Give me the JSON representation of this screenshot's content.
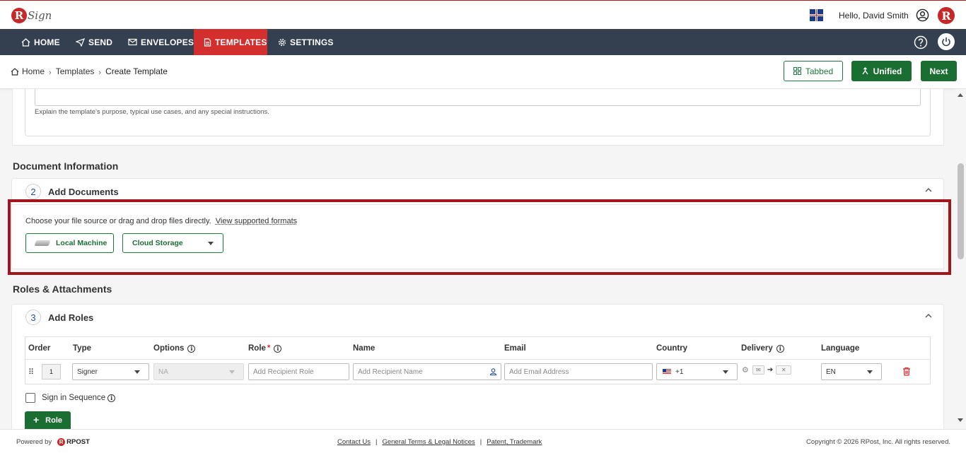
{
  "header": {
    "logo_text": "Sign",
    "greeting": "Hello, David Smith"
  },
  "nav": {
    "items": [
      {
        "label": "HOME",
        "icon": "home-icon"
      },
      {
        "label": "SEND",
        "icon": "send-icon"
      },
      {
        "label": "ENVELOPES",
        "icon": "envelope-icon"
      },
      {
        "label": "TEMPLATES",
        "icon": "document-icon",
        "active": true
      },
      {
        "label": "SETTINGS",
        "icon": "gear-icon"
      }
    ]
  },
  "breadcrumb": {
    "home": "Home",
    "templates": "Templates",
    "current": "Create Template"
  },
  "toolbar": {
    "tabbed_label": "Tabbed",
    "unified_label": "Unified",
    "next_label": "Next"
  },
  "description": {
    "help_text": "Explain the template's purpose, typical use cases, and any special instructions."
  },
  "document_info": {
    "section_title": "Document Information",
    "step_number": "2",
    "panel_title": "Add Documents",
    "instruction": "Choose your file source or drag and drop files directly.",
    "formats_link": "View supported formats",
    "local_machine_label": "Local Machine",
    "cloud_storage_label": "Cloud Storage"
  },
  "roles": {
    "section_title": "Roles & Attachments",
    "step_number": "3",
    "panel_title": "Add Roles",
    "columns": {
      "order": "Order",
      "type": "Type",
      "options": "Options",
      "role": "Role",
      "role_required": "*",
      "name": "Name",
      "email": "Email",
      "country": "Country",
      "delivery": "Delivery",
      "language": "Language"
    },
    "row": {
      "order": "1",
      "type": "Signer",
      "options": "NA",
      "role_placeholder": "Add Recipient Role",
      "name_placeholder": "Add Recipient Name",
      "email_placeholder": "Add Email Address",
      "country_code": "+1",
      "language": "EN"
    },
    "sign_in_sequence_label": "Sign in Sequence",
    "add_role_label": "Role"
  },
  "footer": {
    "powered_by": "Powered by",
    "brand": "RPOST",
    "links": [
      "Contact Us",
      "General Terms & Legal Notices",
      "Patent, Trademark"
    ],
    "copyright": "Copyright © 2026 RPost, Inc. All rights reserved."
  },
  "colors": {
    "brand_red": "#c62828",
    "nav_bg": "#34404f",
    "active_nav": "#d32f2f",
    "primary_green": "#1b6e32",
    "highlight_border": "#a3151a"
  }
}
